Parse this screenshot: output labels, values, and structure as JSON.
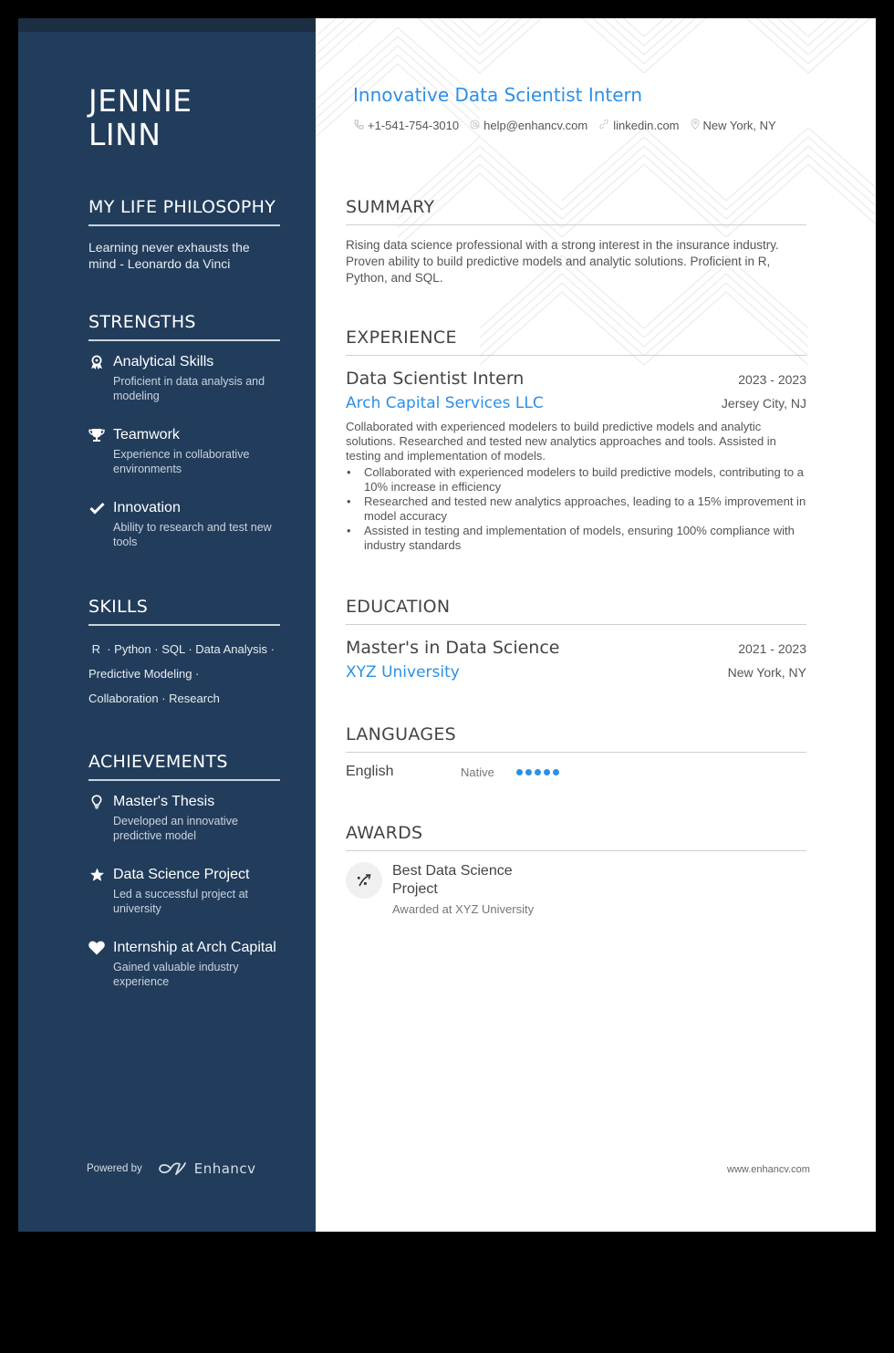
{
  "header": {
    "name_line1": "JENNIE",
    "name_line2": "LINN",
    "job_title": "Innovative Data Scientist Intern",
    "contacts": [
      {
        "icon": "phone-icon",
        "text": "+1-541-754-3010"
      },
      {
        "icon": "at-icon",
        "text": "help@enhancv.com"
      },
      {
        "icon": "link-icon",
        "text": "linkedin.com"
      },
      {
        "icon": "location-pin-icon",
        "text": "New York, NY"
      }
    ]
  },
  "sidebar": {
    "philosophy": {
      "title": "MY LIFE PHILOSOPHY",
      "text": "Learning never exhausts the mind - Leonardo da Vinci"
    },
    "strengths": {
      "title": "STRENGTHS",
      "items": [
        {
          "icon": "award-ribbon-icon",
          "title": "Analytical Skills",
          "desc": "Proficient in data analysis and modeling"
        },
        {
          "icon": "trophy-icon",
          "title": "Teamwork",
          "desc": "Experience in collaborative environments"
        },
        {
          "icon": "checkmark-icon",
          "title": "Innovation",
          "desc": "Ability to research and test new tools"
        }
      ]
    },
    "skills": {
      "title": "SKILLS",
      "line1": " R  · Python · SQL · Data Analysis ·",
      "line2": "Predictive Modeling ·",
      "line3": "Collaboration · Research",
      "items": [
        "R",
        "Python",
        "SQL",
        "Data Analysis",
        "Predictive Modeling",
        "Collaboration",
        "Research"
      ]
    },
    "achievements": {
      "title": "ACHIEVEMENTS",
      "items": [
        {
          "icon": "lightbulb-icon",
          "title": "Master's Thesis",
          "desc": "Developed an innovative predictive model"
        },
        {
          "icon": "star-icon",
          "title": "Data Science Project",
          "desc": "Led a successful project at university"
        },
        {
          "icon": "heart-icon",
          "title": "Internship at Arch Capital",
          "desc": "Gained valuable industry experience"
        }
      ]
    },
    "powered_by": "Powered by",
    "brand": "Enhancv"
  },
  "summary": {
    "title": "SUMMARY",
    "text": "Rising data science professional with a strong interest in the insurance industry. Proven ability to build predictive models and analytic solutions. Proficient in R, Python, and SQL."
  },
  "experience": {
    "title": "EXPERIENCE",
    "entries": [
      {
        "role": "Data Scientist Intern",
        "dates": "2023 - 2023",
        "company": "Arch Capital Services LLC",
        "location": "Jersey City, NJ",
        "description": "Collaborated with experienced modelers to build predictive models and analytic solutions. Researched and tested new analytics approaches and tools. Assisted in testing and implementation of models.",
        "bullets": [
          "Collaborated with experienced modelers to build predictive models, contributing to a 10% increase in efficiency",
          "Researched and tested new analytics approaches, leading to a 15% improvement in model accuracy",
          "Assisted in testing and implementation of models, ensuring 100% compliance with industry standards"
        ]
      }
    ]
  },
  "education": {
    "title": "EDUCATION",
    "entries": [
      {
        "degree": "Master's in Data Science",
        "dates": "2021 - 2023",
        "school": "XYZ University",
        "location": "New York, NY"
      }
    ]
  },
  "languages": {
    "title": "LANGUAGES",
    "items": [
      {
        "name": "English",
        "level": "Native",
        "proficiency": 5,
        "max": 5
      }
    ]
  },
  "awards": {
    "title": "AWARDS",
    "items": [
      {
        "icon": "growth-chart-icon",
        "title": "Best Data Science Project",
        "desc": "Awarded at XYZ University"
      }
    ]
  },
  "footer": {
    "url": "www.enhancv.com"
  },
  "colors": {
    "sidebar": "#223d5b",
    "accent": "#2d8fe6"
  }
}
